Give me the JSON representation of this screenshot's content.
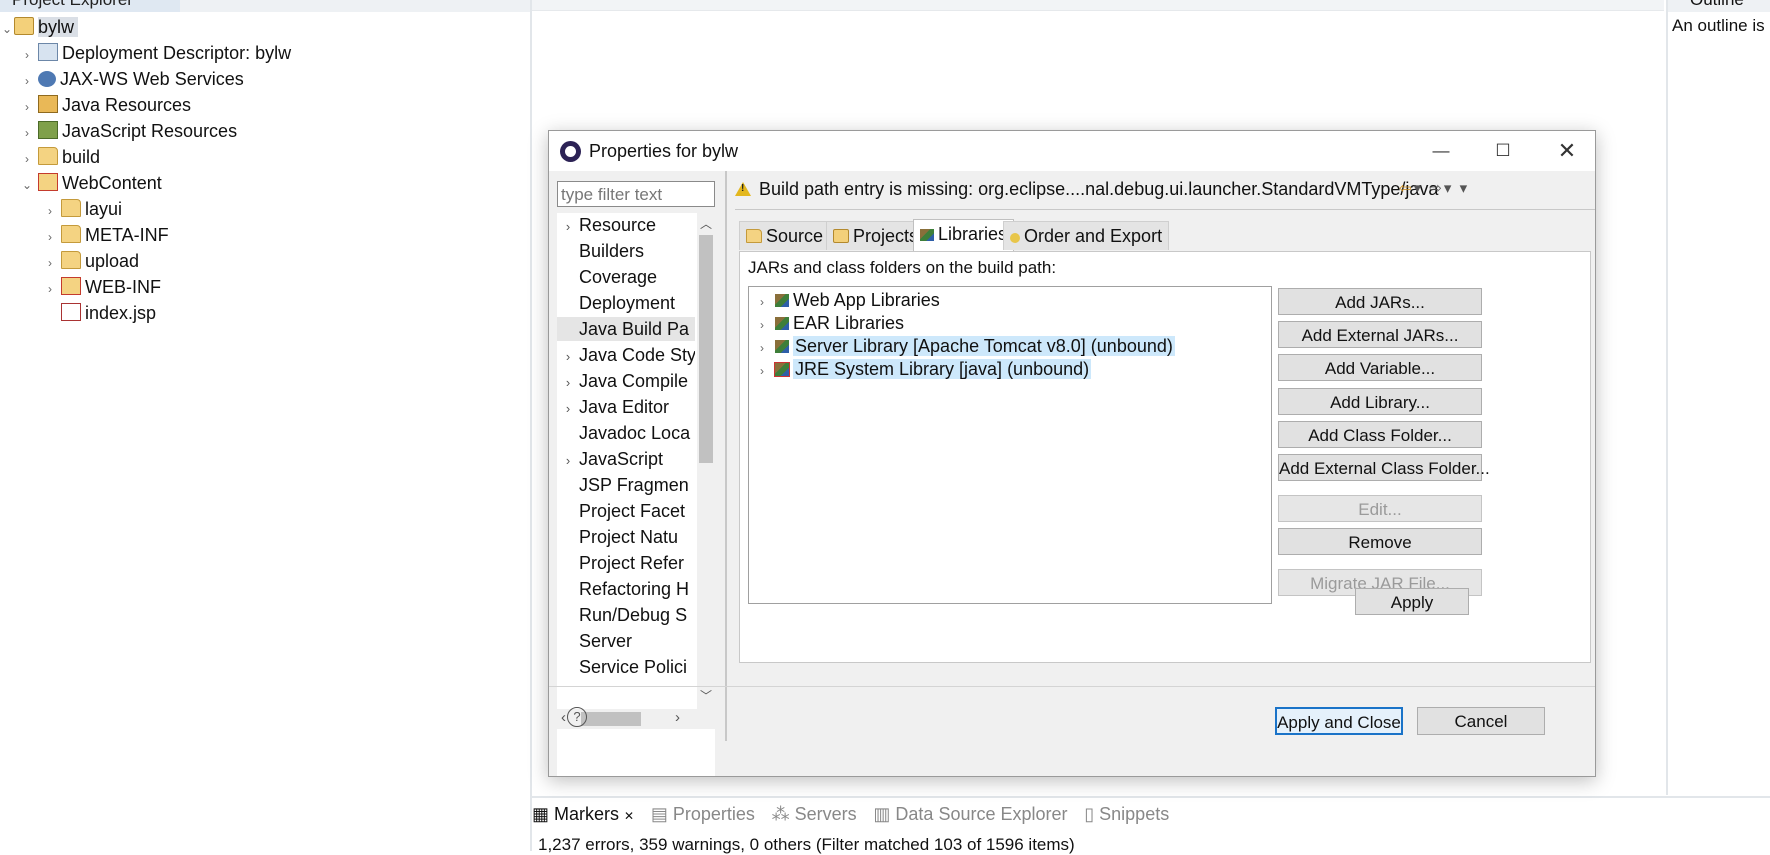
{
  "explorer": {
    "title": "Project Explorer",
    "project": "bylw",
    "items": [
      "Deployment Descriptor: bylw",
      "JAX-WS Web Services",
      "Java Resources",
      "JavaScript Resources",
      "build",
      "WebContent"
    ],
    "webcontent_children": [
      "layui",
      "META-INF",
      "upload",
      "WEB-INF",
      "index.jsp"
    ]
  },
  "outline": {
    "title": "Outline",
    "text": "An outline is"
  },
  "dialog": {
    "title": "Properties for bylw",
    "filter_placeholder": "type filter text",
    "nav": [
      "Resource",
      "Builders",
      "Coverage",
      "Deployment",
      "Java Build Pa",
      "Java Code Sty",
      "Java Compile",
      "Java Editor",
      "Javadoc Loca",
      "JavaScript",
      "JSP Fragmen",
      "Project Facet",
      "Project Natu",
      "Project Refer",
      "Refactoring H",
      "Run/Debug S",
      "Server",
      "Service Polici"
    ],
    "message": "Build path entry is missing: org.eclipse....nal.debug.ui.launcher.StandardVMType/java",
    "tabs": [
      "Source",
      "Projects",
      "Libraries",
      "Order and Export"
    ],
    "body_label": "JARs and class folders on the build path:",
    "libraries": [
      "Web App Libraries",
      "EAR Libraries",
      "Server Library [Apache Tomcat v8.0] (unbound)",
      "JRE System Library [java] (unbound)"
    ],
    "buttons": {
      "add_jars": "Add JARs...",
      "add_external_jars": "Add External JARs...",
      "add_variable": "Add Variable...",
      "add_library": "Add Library...",
      "add_class_folder": "Add Class Folder...",
      "add_external_class_folder": "Add External Class Folder...",
      "edit": "Edit...",
      "remove": "Remove",
      "migrate": "Migrate JAR File...",
      "apply": "Apply",
      "apply_close": "Apply and Close",
      "cancel": "Cancel"
    },
    "help": "?"
  },
  "bottom": {
    "tabs": [
      "Markers",
      "Properties",
      "Servers",
      "Data Source Explorer",
      "Snippets"
    ],
    "status": "1,237 errors, 359 warnings, 0 others (Filter matched 103 of 1596 items)"
  }
}
